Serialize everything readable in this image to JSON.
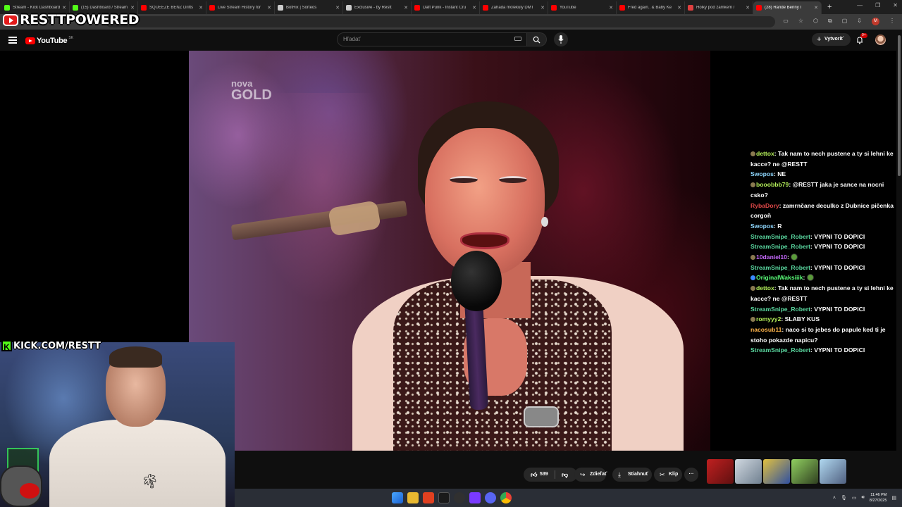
{
  "overlay": {
    "brand": "RESTTPOWERED",
    "kick_channel": "KICK.COM/RESTT"
  },
  "browser": {
    "tabs": [
      {
        "title": "Stream - Kick Dashboard",
        "color": "#53fc18"
      },
      {
        "title": "(15) Dashboard / Stream",
        "color": "#53fc18"
      },
      {
        "title": "SQUEEZE BENZ Drifts",
        "color": "#ff0000"
      },
      {
        "title": "Live Stream History for",
        "color": "#ff0000"
      },
      {
        "title": "BotRix | Sorteos",
        "color": "#cccccc"
      },
      {
        "title": "Exclusive - by Restt",
        "color": "#cccccc"
      },
      {
        "title": "Daft Punk - Instant Cru",
        "color": "#ff0000"
      },
      {
        "title": "Záhada molekuly DMT",
        "color": "#ff0000"
      },
      {
        "title": "YouTube",
        "color": "#ff0000"
      },
      {
        "title": "Fred again.. & Baby Ke",
        "color": "#ff0000"
      },
      {
        "title": "Holky pod zámkem / ",
        "color": "#e04040"
      },
      {
        "title": "(28) Rande Benny I",
        "color": "#ff0000",
        "active": true
      }
    ],
    "url_fragment": "eSV02E"
  },
  "youtube": {
    "logo": "YouTube",
    "region": "SK",
    "search_placeholder": "Hľadať",
    "create_label": "Vytvoriť",
    "notif_count": "9+",
    "likes": "539",
    "share_label": "Zdieľať",
    "download_label": "Stiahnuť",
    "clip_label": "Klip",
    "more_label": "···"
  },
  "video": {
    "channel_line1": "nova",
    "channel_line2": "GOLD"
  },
  "chat": {
    "messages": [
      {
        "user": "dettox",
        "color": "#b5f05a",
        "badge": "#8a7a50",
        "text": "Tak nam to nech pustene a ty si lehni ke kacce? ne @RESTT"
      },
      {
        "user": "Swopos",
        "color": "#8fd8ff",
        "text": "NE"
      },
      {
        "user": "booobbb79",
        "color": "#b5f05a",
        "badge": "#8a7a50",
        "text": "@RESTT jaka je sance na nocni csko?"
      },
      {
        "user": "RybaDory",
        "color": "#e04848",
        "text": "zamrnčane deculko z Dubnice pičenka corgoň"
      },
      {
        "user": "Swopos",
        "color": "#8fd8ff",
        "text": "R"
      },
      {
        "user": "StreamSnipe_Robert",
        "color": "#5ad8a0",
        "text": "VYPNI TO DOPICI"
      },
      {
        "user": "StreamSnipe_Robert",
        "color": "#5ad8a0",
        "text": "VYPNI TO DOPICI"
      },
      {
        "user": "10daniel10",
        "color": "#c86aff",
        "badge": "#8a7a50",
        "text": "",
        "emote": true
      },
      {
        "user": "StreamSnipe_Robert",
        "color": "#5ad8a0",
        "text": "VYPNI TO DOPICI"
      },
      {
        "user": "OriginalWaksiiik",
        "color": "#5aff7a",
        "badge": "#3a8aff",
        "text": "",
        "emote": true
      },
      {
        "user": "dettox",
        "color": "#b5f05a",
        "badge": "#8a7a50",
        "text": "Tak nam to nech pustene a ty si lehni ke kacce? ne @RESTT"
      },
      {
        "user": "StreamSnipe_Robert",
        "color": "#5ad8a0",
        "text": "VYPNI TO DOPICI"
      },
      {
        "user": "romyyy2",
        "color": "#b5f05a",
        "badge": "#8a7a50",
        "text": "SLABY KUS"
      },
      {
        "user": "nacosub11",
        "color": "#ffb44a",
        "text": "naco si to jebes do papule ked ti je stoho pokazde napicu?"
      },
      {
        "user": "StreamSnipe_Robert",
        "color": "#5ad8a0",
        "text": "VYPNI TO DOPICI"
      }
    ]
  },
  "taskbar": {
    "time": "11:46 PM",
    "date": "8/27/2025"
  }
}
